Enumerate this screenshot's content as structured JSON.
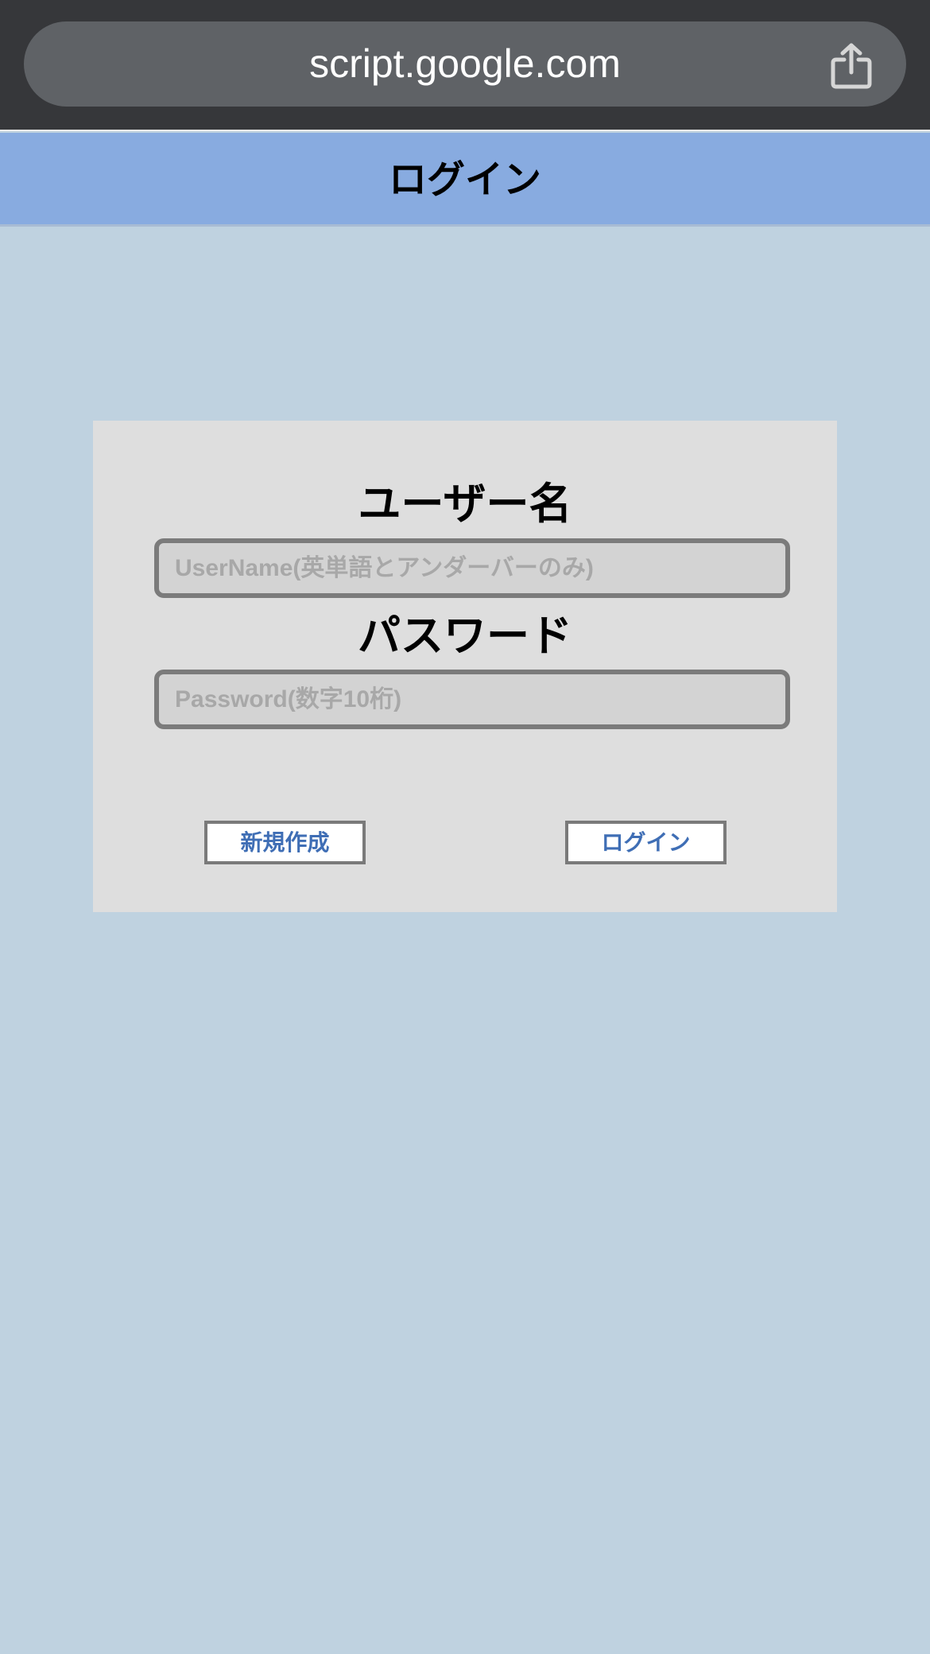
{
  "browser": {
    "url": "script.google.com",
    "share_icon": "share-icon"
  },
  "header": {
    "title": "ログイン"
  },
  "login_form": {
    "username_label": "ユーザー名",
    "username_value": "",
    "username_placeholder": "UserName(英単語とアンダーバーのみ)",
    "password_label": "パスワード",
    "password_value": "",
    "password_placeholder": "Password(数字10桁)",
    "new_account_button": "新規作成",
    "login_button": "ログイン"
  },
  "colors": {
    "browser_bar": "#36373a",
    "url_pill": "#5f6266",
    "header_bg": "#88abe0",
    "page_bg": "#bfd2e0",
    "card_bg": "#dedede",
    "button_text": "#3f6eb5"
  }
}
